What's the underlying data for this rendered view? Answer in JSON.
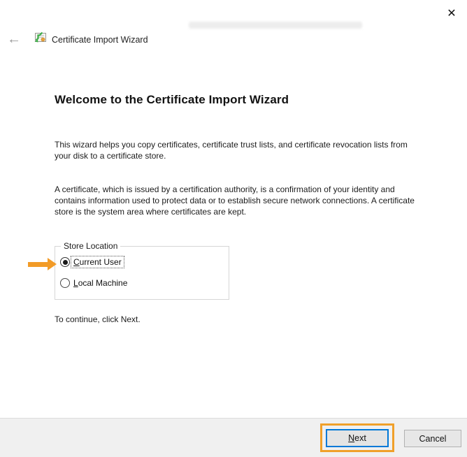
{
  "window": {
    "close_glyph": "✕"
  },
  "header": {
    "back_glyph": "←",
    "title": "Certificate Import Wizard"
  },
  "main": {
    "heading": "Welcome to the Certificate Import Wizard",
    "paragraph1": "This wizard helps you copy certificates, certificate trust lists, and certificate revocation lists from your disk to a certificate store.",
    "paragraph2": "A certificate, which is issued by a certification authority, is a confirmation of your identity and contains information used to protect data or to establish secure network connections. A certificate store is the system area where certificates are kept.",
    "store_location": {
      "legend": "Store Location",
      "options": [
        {
          "mnemonic": "C",
          "rest": "urrent User",
          "selected": true
        },
        {
          "mnemonic": "L",
          "rest": "ocal Machine",
          "selected": false
        }
      ]
    },
    "continue_hint": "To continue, click Next."
  },
  "footer": {
    "next_button": {
      "mnemonic": "N",
      "rest": "ext"
    },
    "cancel_label": "Cancel"
  },
  "colors": {
    "annotation_orange": "#f0a02a",
    "default_button_blue": "#0078d7",
    "footer_gray": "#f0f0f0"
  }
}
